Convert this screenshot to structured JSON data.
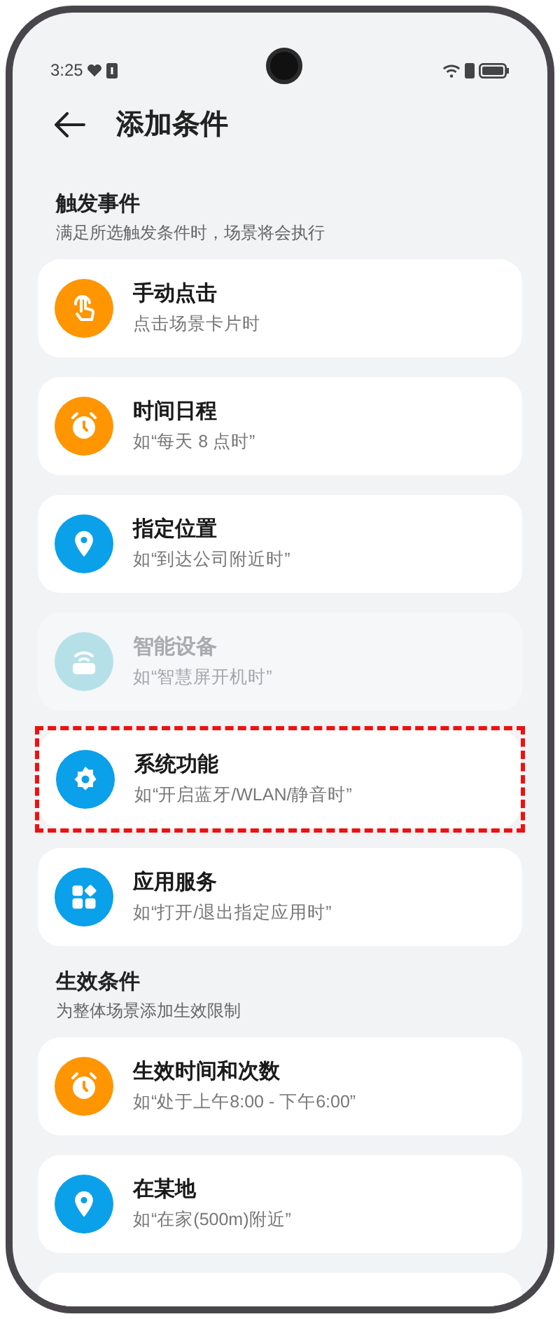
{
  "status_bar": {
    "time": "3:25"
  },
  "header": {
    "title": "添加条件"
  },
  "sections": [
    {
      "title": "触发事件",
      "subtitle": "满足所选触发条件时，场景将会执行",
      "items": [
        {
          "kind": "tap",
          "color": "#ff9500",
          "title": "手动点击",
          "hint": "点击场景卡片时",
          "disabled": false,
          "highlighted": false
        },
        {
          "kind": "alarm",
          "color": "#ff9500",
          "title": "时间日程",
          "hint": "如“每天 8 点时”",
          "disabled": false,
          "highlighted": false
        },
        {
          "kind": "pin",
          "color": "#0aa0ea",
          "title": "指定位置",
          "hint": "如“到达公司附近时”",
          "disabled": false,
          "highlighted": false
        },
        {
          "kind": "router",
          "color": "#b5e0e8",
          "title": "智能设备",
          "hint": "如“智慧屏开机时”",
          "disabled": true,
          "highlighted": false
        },
        {
          "kind": "gear",
          "color": "#0aa0ea",
          "title": "系统功能",
          "hint": "如“开启蓝牙/WLAN/静音时”",
          "disabled": false,
          "highlighted": true
        },
        {
          "kind": "apps",
          "color": "#0aa0ea",
          "title": "应用服务",
          "hint": "如“打开/退出指定应用时”",
          "disabled": false,
          "highlighted": false
        }
      ]
    },
    {
      "title": "生效条件",
      "subtitle": "为整体场景添加生效限制",
      "items": [
        {
          "kind": "alarm",
          "color": "#ff9500",
          "title": "生效时间和次数",
          "hint": "如“处于上午8:00 - 下午6:00”",
          "disabled": false,
          "highlighted": false
        },
        {
          "kind": "pin",
          "color": "#0aa0ea",
          "title": "在某地",
          "hint": "如“在家(500m)附近”",
          "disabled": false,
          "highlighted": false
        }
      ]
    }
  ]
}
